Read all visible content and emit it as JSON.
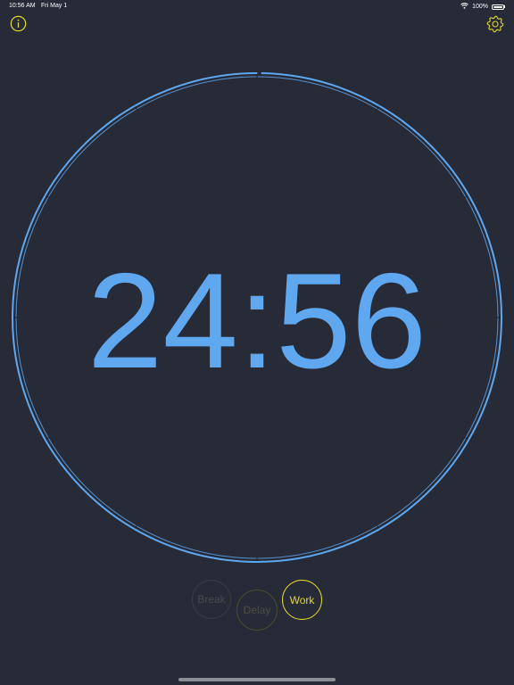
{
  "status_bar": {
    "time": "10:56 AM",
    "date": "Fri May 1",
    "battery_text": "100%",
    "battery_level": 1.0
  },
  "toolbar": {
    "info_icon": "info-icon",
    "settings_icon": "gear-icon"
  },
  "timer": {
    "display": "24:56",
    "progress_remaining_fraction": 0.9973
  },
  "modes": {
    "break_label": "Break",
    "delay_label": "Delay",
    "work_label": "Work",
    "active": "Work"
  },
  "colors": {
    "background": "#272a37",
    "accent_blue": "#5fa7ef",
    "accent_yellow": "#e3d72b",
    "inactive": "#484b4d"
  }
}
